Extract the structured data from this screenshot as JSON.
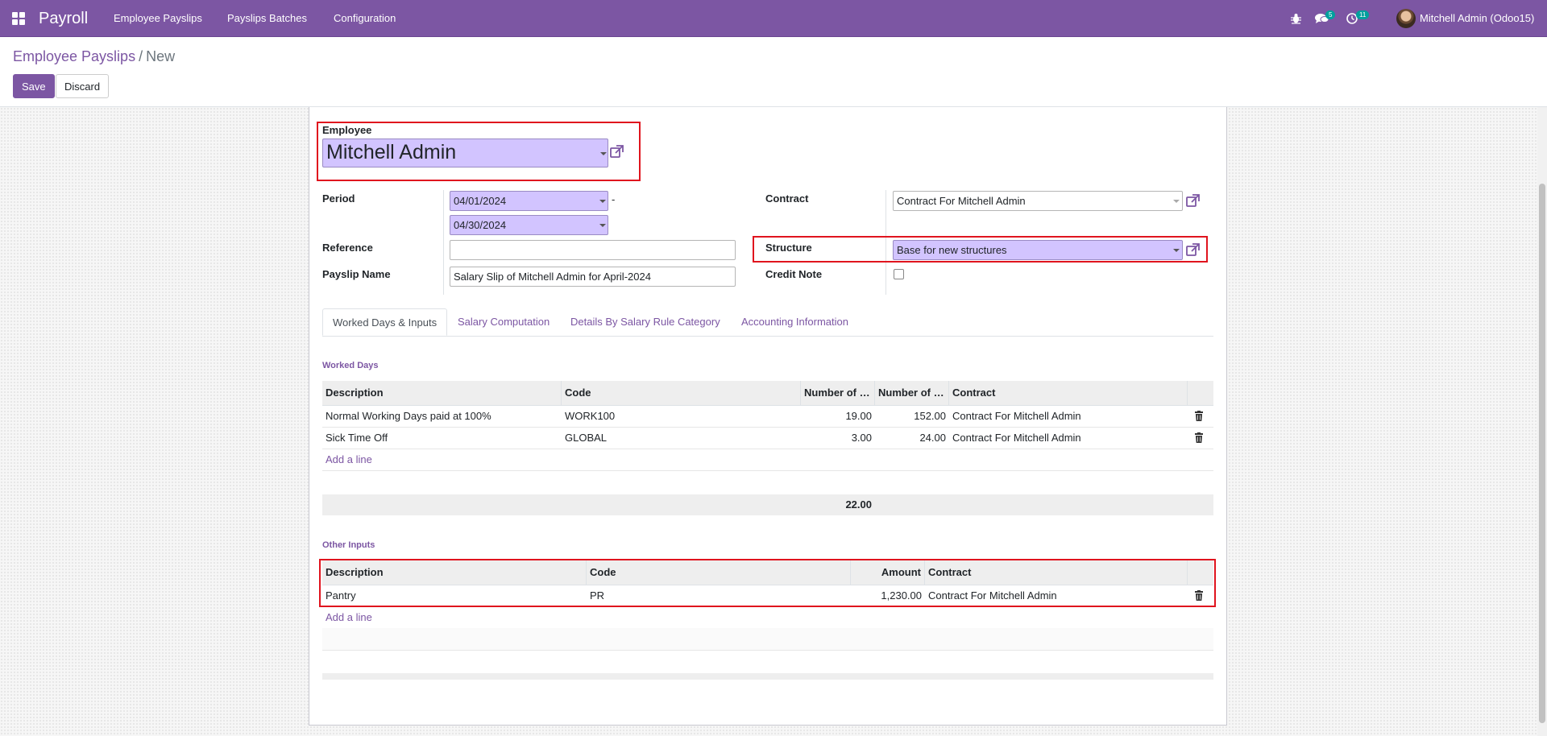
{
  "navbar": {
    "brand": "Payroll",
    "menu": [
      "Employee Payslips",
      "Payslips Batches",
      "Configuration"
    ],
    "messages_count": "5",
    "activities_count": "11",
    "user": "Mitchell Admin (Odoo15)"
  },
  "breadcrumb": {
    "parent": "Employee Payslips",
    "separator": "/",
    "current": "New"
  },
  "buttons": {
    "save": "Save",
    "discard": "Discard"
  },
  "form": {
    "employee_label": "Employee",
    "employee_value": "Mitchell Admin",
    "period_label": "Period",
    "period_from": "04/01/2024",
    "period_dash": "-",
    "period_to": "04/30/2024",
    "reference_label": "Reference",
    "reference_value": "",
    "payslip_name_label": "Payslip Name",
    "payslip_name_value": "Salary Slip of Mitchell Admin for April-2024",
    "contract_label": "Contract",
    "contract_value": "Contract For Mitchell Admin",
    "structure_label": "Structure",
    "structure_value": "Base for new structures",
    "credit_note_label": "Credit Note",
    "credit_note_checked": false
  },
  "tabs": [
    {
      "label": "Worked Days & Inputs",
      "active": true
    },
    {
      "label": "Salary Computation",
      "active": false
    },
    {
      "label": "Details By Salary Rule Category",
      "active": false
    },
    {
      "label": "Accounting Information",
      "active": false
    }
  ],
  "worked_days": {
    "title": "Worked Days",
    "columns": [
      "Description",
      "Code",
      "Number of …",
      "Number of …",
      "Contract"
    ],
    "rows": [
      {
        "description": "Normal Working Days paid at 100%",
        "code": "WORK100",
        "days": "19.00",
        "hours": "152.00",
        "contract": "Contract For Mitchell Admin"
      },
      {
        "description": "Sick Time Off",
        "code": "GLOBAL",
        "days": "3.00",
        "hours": "24.00",
        "contract": "Contract For Mitchell Admin"
      }
    ],
    "add_line": "Add a line",
    "total_days": "22.00"
  },
  "other_inputs": {
    "title": "Other Inputs",
    "columns": [
      "Description",
      "Code",
      "Amount",
      "Contract"
    ],
    "rows": [
      {
        "description": "Pantry",
        "code": "PR",
        "amount": "1,230.00",
        "contract": "Contract For Mitchell Admin"
      }
    ],
    "add_line": "Add a line"
  },
  "colors": {
    "brand": "#7c56a3",
    "required_field": "#d2c4ff",
    "highlight": "#e0141e"
  }
}
